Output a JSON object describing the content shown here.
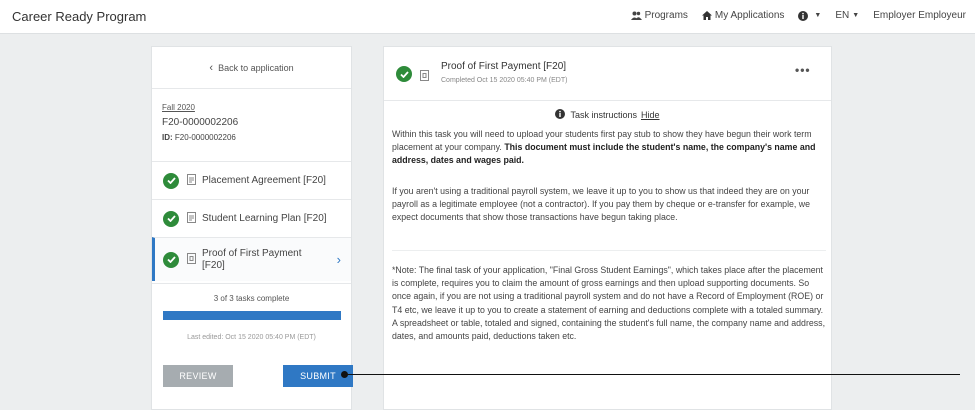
{
  "app": {
    "title": "Career Ready Program"
  },
  "nav": {
    "programs": "Programs",
    "my_applications": "My Applications",
    "language": "EN",
    "user": "Employer Employeur"
  },
  "sidebar": {
    "back_label": "Back to application",
    "term": "Fall 2020",
    "app_code": "F20-0000002206",
    "id_label": "ID:",
    "id_value": "F20-0000002206",
    "tasks": [
      {
        "label": "Placement Agreement [F20]",
        "status": "complete"
      },
      {
        "label": "Student Learning Plan [F20]",
        "status": "complete"
      },
      {
        "label": "Proof of First Payment [F20]",
        "status": "complete",
        "active": true
      }
    ],
    "progress_text": "3 of 3 tasks complete",
    "progress_fraction": 1.0,
    "last_edited": "Last edited: Oct 15 2020 05:40 PM (EDT)",
    "review_label": "REVIEW",
    "submit_label": "SUBMIT"
  },
  "task": {
    "title": "Proof of First Payment [F20]",
    "completed": "Completed Oct 15 2020 05:40 PM (EDT)",
    "more": "•••",
    "instructions_label": "Task instructions",
    "hide_label": "Hide",
    "para1_a": "Within this task you will need to upload your students first pay stub to show they have begun their work term placement at your company. ",
    "para1_b": "This document must include the student's name, the company's name and address, dates and wages paid.",
    "para2": "If you aren't using a traditional payroll system, we leave it up to you to show us that indeed they are on your payroll as a legitimate employee (not a contractor). If you pay them by cheque or e-transfer for example, we expect documents that show those transactions have begun taking place.",
    "para3": "*Note: The final task of your application, \"Final Gross Student Earnings\", which takes place after the placement is complete, requires you to claim the amount of gross earnings and then upload supporting documents.  So once again, if you are not using a traditional payroll system and do not have a Record of Employment (ROE) or T4 etc, we leave it up to you to create a statement of earning and deductions complete with a totaled summary.  A spreadsheet or table, totaled and signed, containing the student's full name, the company name and address, dates, and amounts paid, deductions taken etc."
  },
  "colors": {
    "accent": "#2f78c4",
    "success": "#2e8b3a",
    "disabled": "#a6acb0"
  },
  "icons": [
    "users-icon",
    "home-icon",
    "info-icon",
    "chevron-left-icon",
    "check-circle-icon",
    "document-icon",
    "chevron-right-icon",
    "more-icon"
  ]
}
